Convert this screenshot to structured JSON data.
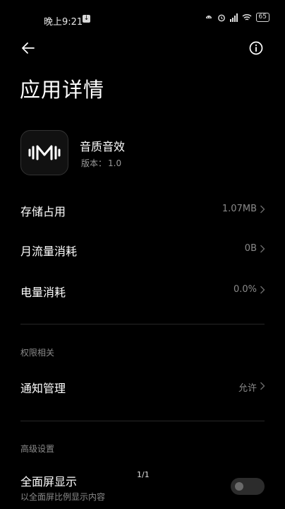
{
  "status": {
    "time": "晚上9:21",
    "battery": "65",
    "notif_glyph": "↓"
  },
  "header": {
    "title": "应用详情",
    "back_icon": "arrow-left-icon",
    "info_icon": "info-circle-icon"
  },
  "app": {
    "name": "音质音效",
    "version_label": "版本：",
    "version_value": "1.0"
  },
  "rows": [
    {
      "label": "存储占用",
      "value": "1.07MB"
    },
    {
      "label": "月流量消耗",
      "value": "0B"
    },
    {
      "label": "电量消耗",
      "value": "0.0%"
    }
  ],
  "permissions": {
    "section_title": "权限相关",
    "item_label": "通知管理",
    "item_value": "允许"
  },
  "advanced": {
    "section_title": "高级设置",
    "fullscreen_label": "全面屏显示",
    "fullscreen_sub": "以全面屏比例显示内容",
    "toggle_on": false
  },
  "page_indicator": "1/1"
}
